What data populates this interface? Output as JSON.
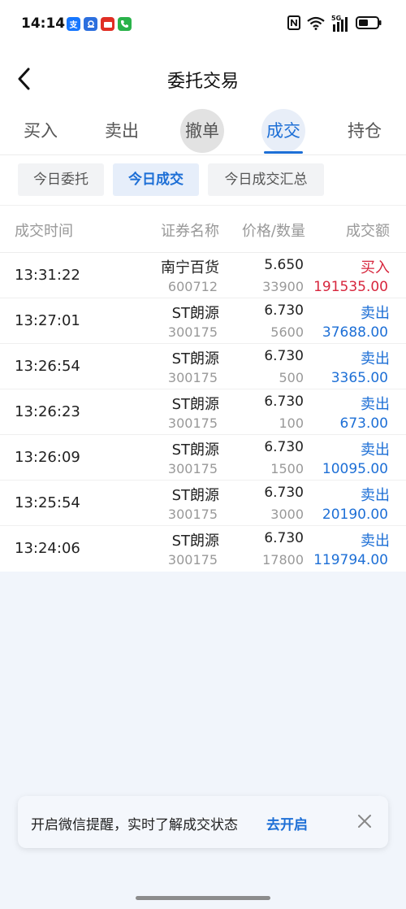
{
  "status_bar": {
    "time": "14:14",
    "network_label": "5G"
  },
  "nav": {
    "title": "委托交易"
  },
  "main_tabs": [
    {
      "label": "买入"
    },
    {
      "label": "卖出"
    },
    {
      "label": "撤单"
    },
    {
      "label": "成交"
    },
    {
      "label": "持仓"
    }
  ],
  "sub_tabs": [
    {
      "label": "今日委托"
    },
    {
      "label": "今日成交"
    },
    {
      "label": "今日成交汇总"
    }
  ],
  "table": {
    "headers": {
      "time": "成交时间",
      "name": "证券名称",
      "price_qty": "价格/数量",
      "amount": "成交额"
    },
    "rows": [
      {
        "time": "13:31:22",
        "name": "南宁百货",
        "code": "600712",
        "price": "5.650",
        "qty": "33900",
        "direction": "买入",
        "amount": "191535.00",
        "side": "buy"
      },
      {
        "time": "13:27:01",
        "name": "ST朗源",
        "code": "300175",
        "price": "6.730",
        "qty": "5600",
        "direction": "卖出",
        "amount": "37688.00",
        "side": "sell"
      },
      {
        "time": "13:26:54",
        "name": "ST朗源",
        "code": "300175",
        "price": "6.730",
        "qty": "500",
        "direction": "卖出",
        "amount": "3365.00",
        "side": "sell"
      },
      {
        "time": "13:26:23",
        "name": "ST朗源",
        "code": "300175",
        "price": "6.730",
        "qty": "100",
        "direction": "卖出",
        "amount": "673.00",
        "side": "sell"
      },
      {
        "time": "13:26:09",
        "name": "ST朗源",
        "code": "300175",
        "price": "6.730",
        "qty": "1500",
        "direction": "卖出",
        "amount": "10095.00",
        "side": "sell"
      },
      {
        "time": "13:25:54",
        "name": "ST朗源",
        "code": "300175",
        "price": "6.730",
        "qty": "3000",
        "direction": "卖出",
        "amount": "20190.00",
        "side": "sell"
      },
      {
        "time": "13:24:06",
        "name": "ST朗源",
        "code": "300175",
        "price": "6.730",
        "qty": "17800",
        "direction": "卖出",
        "amount": "119794.00",
        "side": "sell"
      }
    ]
  },
  "banner": {
    "text": "开启微信提醒，实时了解成交状态",
    "action": "去开启"
  },
  "colors": {
    "accent": "#1d6fd6",
    "buy": "#d7263d",
    "sell": "#1d6fd6",
    "muted": "#999999"
  }
}
